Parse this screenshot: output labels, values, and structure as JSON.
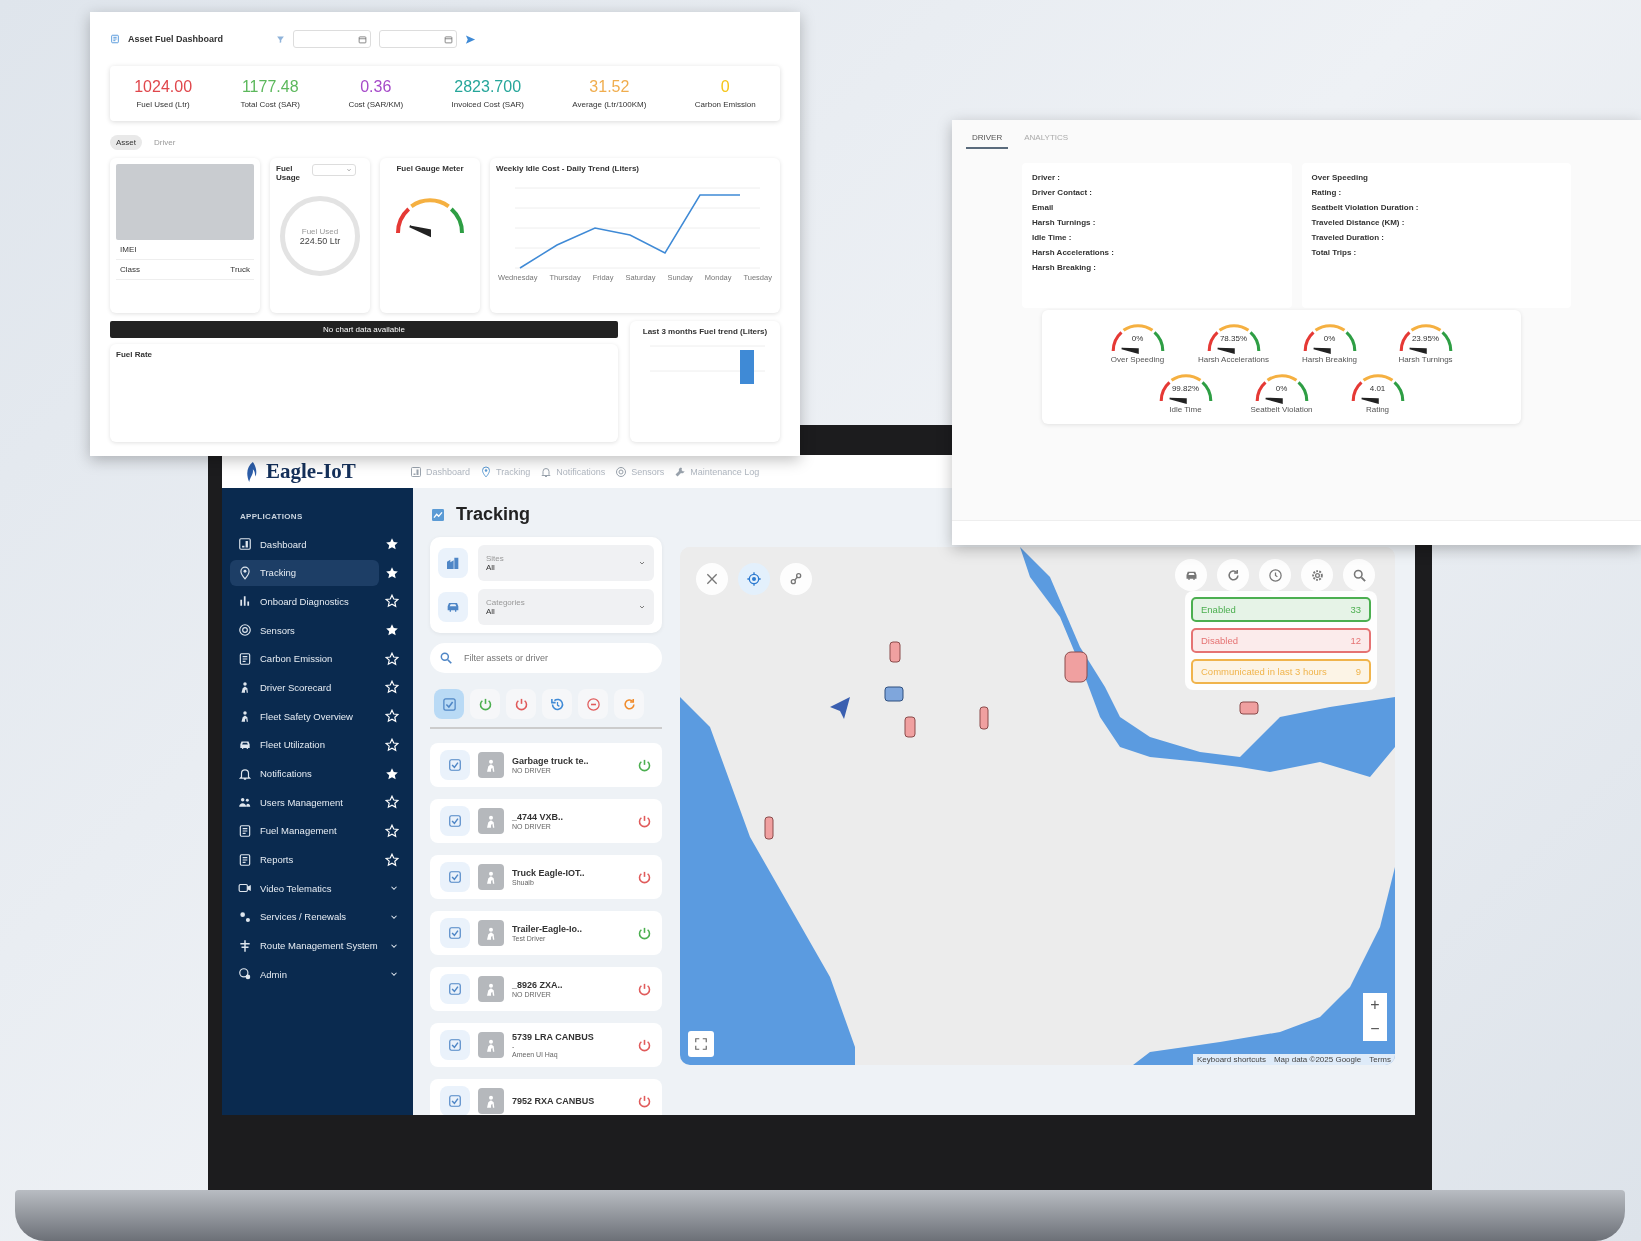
{
  "fuel_dashboard": {
    "title": "Asset Fuel Dashboard",
    "kpis": [
      {
        "value": "1024.00",
        "label": "Fuel Used (Ltr)",
        "color": "#e0474c"
      },
      {
        "value": "1177.48",
        "label": "Total Cost (SAR)",
        "color": "#5cb85c"
      },
      {
        "value": "0.36",
        "label": "Cost (SAR/KM)",
        "color": "#a64ac9"
      },
      {
        "value": "2823.700",
        "label": "Invoiced Cost (SAR)",
        "color": "#26a69a"
      },
      {
        "value": "31.52",
        "label": "Average (Ltr/100KM)",
        "color": "#f0ad4e"
      },
      {
        "value": "0",
        "label": "Carbon Emission",
        "color": "#f5c518"
      }
    ],
    "tabs": [
      {
        "label": "Asset",
        "selected": true
      },
      {
        "label": "Driver",
        "selected": false
      }
    ],
    "asset_info": [
      {
        "label": "IMEI"
      },
      {
        "label": "Class",
        "value": "Truck"
      }
    ],
    "fuel_usage": {
      "title": "Fuel Usage",
      "circle_label": "Fuel Used",
      "circle_value": "224.50 Ltr"
    },
    "gauge": {
      "title": "Fuel Gauge Meter",
      "level": 0.1
    },
    "weekly_chart": {
      "title": "Weekly Idle Cost - Daily Trend (Liters)",
      "x_labels": [
        "Wednesday",
        "Thursday",
        "Friday",
        "Saturday",
        "Sunday",
        "Monday",
        "Tuesday"
      ]
    },
    "no_data_banner": "No chart data available",
    "fuel_rate_title": "Fuel Rate",
    "trend_title": "Last 3 months Fuel trend (Liters)"
  },
  "driver_window": {
    "tabs": [
      {
        "label": "DRIVER",
        "selected": true
      },
      {
        "label": "ANALYTICS",
        "selected": false
      }
    ],
    "info_left": [
      "Driver :",
      "Driver Contact :",
      "Email",
      "Harsh Turnings :",
      "Idle Time :",
      "Harsh Accelerations :",
      "Harsh Breaking :"
    ],
    "info_right": [
      "Over Speeding",
      "Rating :",
      "Seatbelt Violation Duration :",
      "Traveled Distance (KM) :",
      "Traveled Duration :",
      "Total Trips :"
    ],
    "gauges": [
      {
        "value": "0%",
        "label": "Over Speeding"
      },
      {
        "value": "78.35%",
        "label": "Harsh Accelerations"
      },
      {
        "value": "0%",
        "label": "Harsh Breaking"
      },
      {
        "value": "23.95%",
        "label": "Harsh Turnings"
      },
      {
        "value": "99.82%",
        "label": "Idle Time"
      },
      {
        "value": "0%",
        "label": "Seatbelt Violation"
      },
      {
        "value": "4.01",
        "label": "Rating"
      }
    ]
  },
  "app": {
    "logo": "Eagle-IoT",
    "nav": [
      "Dashboard",
      "Tracking",
      "Notifications",
      "Sensors",
      "Maintenance Log"
    ],
    "sidebar": {
      "heading": "APPLICATIONS",
      "items": [
        {
          "label": "Dashboard",
          "kind": "star",
          "starred": true,
          "selected": false
        },
        {
          "label": "Tracking",
          "kind": "star",
          "starred": true,
          "selected": true
        },
        {
          "label": "Onboard Diagnostics",
          "kind": "star",
          "starred": false,
          "selected": false
        },
        {
          "label": "Sensors",
          "kind": "star",
          "starred": true,
          "selected": false
        },
        {
          "label": "Carbon Emission",
          "kind": "star",
          "starred": false,
          "selected": false
        },
        {
          "label": "Driver Scorecard",
          "kind": "star",
          "starred": false,
          "selected": false
        },
        {
          "label": "Fleet Safety Overview",
          "kind": "star",
          "starred": false,
          "selected": false
        },
        {
          "label": "Fleet Utilization",
          "kind": "star",
          "starred": false,
          "selected": false
        },
        {
          "label": "Notifications",
          "kind": "star",
          "starred": true,
          "selected": false
        },
        {
          "label": "Users Management",
          "kind": "star",
          "starred": false,
          "selected": false
        },
        {
          "label": "Fuel Management",
          "kind": "star",
          "starred": false,
          "selected": false
        },
        {
          "label": "Reports",
          "kind": "star",
          "starred": false,
          "selected": false
        },
        {
          "label": "Video Telematics",
          "kind": "group",
          "expanded": false,
          "selected": false
        },
        {
          "label": "Services / Renewals",
          "kind": "group",
          "expanded": false,
          "selected": false
        },
        {
          "label": "Route Management System",
          "kind": "group",
          "expanded": false,
          "selected": false
        },
        {
          "label": "Admin",
          "kind": "group",
          "expanded": false,
          "selected": false
        }
      ]
    },
    "page_title": "Tracking",
    "filters": [
      {
        "label": "Sites",
        "value": "All"
      },
      {
        "label": "Categories",
        "value": "All"
      }
    ],
    "search": {
      "placeholder": "Filter assets or driver"
    },
    "status_filters": [
      {
        "kind": "all",
        "selected": true
      },
      {
        "kind": "on",
        "selected": false
      },
      {
        "kind": "off",
        "selected": false
      },
      {
        "kind": "history",
        "selected": false
      },
      {
        "kind": "idle",
        "selected": false
      },
      {
        "kind": "refresh",
        "selected": false
      }
    ],
    "assets": [
      {
        "name": "Garbage truck te..",
        "driver": "NO DRIVER",
        "on": true
      },
      {
        "name": "_4744 VXB..",
        "driver": "NO DRIVER",
        "on": false
      },
      {
        "name": "Truck Eagle-IOT..",
        "driver": "Shuaib",
        "on": false
      },
      {
        "name": "Trailer-Eagle-Io..",
        "driver": "Test Driver",
        "on": true
      },
      {
        "name": "_8926 ZXA..",
        "driver": "NO DRIVER",
        "on": false
      },
      {
        "name": "5739 LRA CANBUS",
        "extra": "-",
        "driver": "Ameen Ul Haq",
        "on": false
      },
      {
        "name": "7952 RXA CANBUS",
        "on": false
      }
    ],
    "map": {
      "legend": [
        {
          "label": "Enabled",
          "count": "33",
          "color": "#4caf50"
        },
        {
          "label": "Disabled",
          "count": "12",
          "color": "#e57373"
        },
        {
          "label": "Communicated in last 3 hours",
          "count": "9",
          "color": "#f0b44c"
        }
      ],
      "zoom_controls": [
        "+",
        "−"
      ],
      "attribution": [
        "Keyboard shortcuts",
        "Map data ©2025 Google",
        "Terms"
      ]
    }
  }
}
